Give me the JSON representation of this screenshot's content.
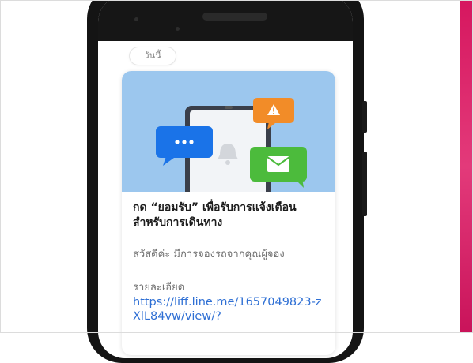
{
  "chat": {
    "date_chip": "วันนี้"
  },
  "notification_card": {
    "title": "กด “ยอมรับ” เพื่อรับการแจ้งเตือนสำหรับการเดินทาง",
    "greeting": "สวัสดีค่ะ มีการจองรถจากคุณผู้จอง",
    "details_label": "รายละเอียด",
    "link_text": "https://liff.line.me/1657049823-zXlL84vw/view/?"
  },
  "colors": {
    "hero_background": "#9cc7ee",
    "bubble_blue": "#1a73e8",
    "bubble_orange": "#f28c28",
    "bubble_green": "#4cbb3c",
    "link": "#2e6fd4",
    "accent_strip": "#d6175f"
  },
  "icons": {
    "hero": [
      "phone-illustration",
      "chat-bubble-icon",
      "warning-icon",
      "mail-icon",
      "bell-icon"
    ]
  }
}
